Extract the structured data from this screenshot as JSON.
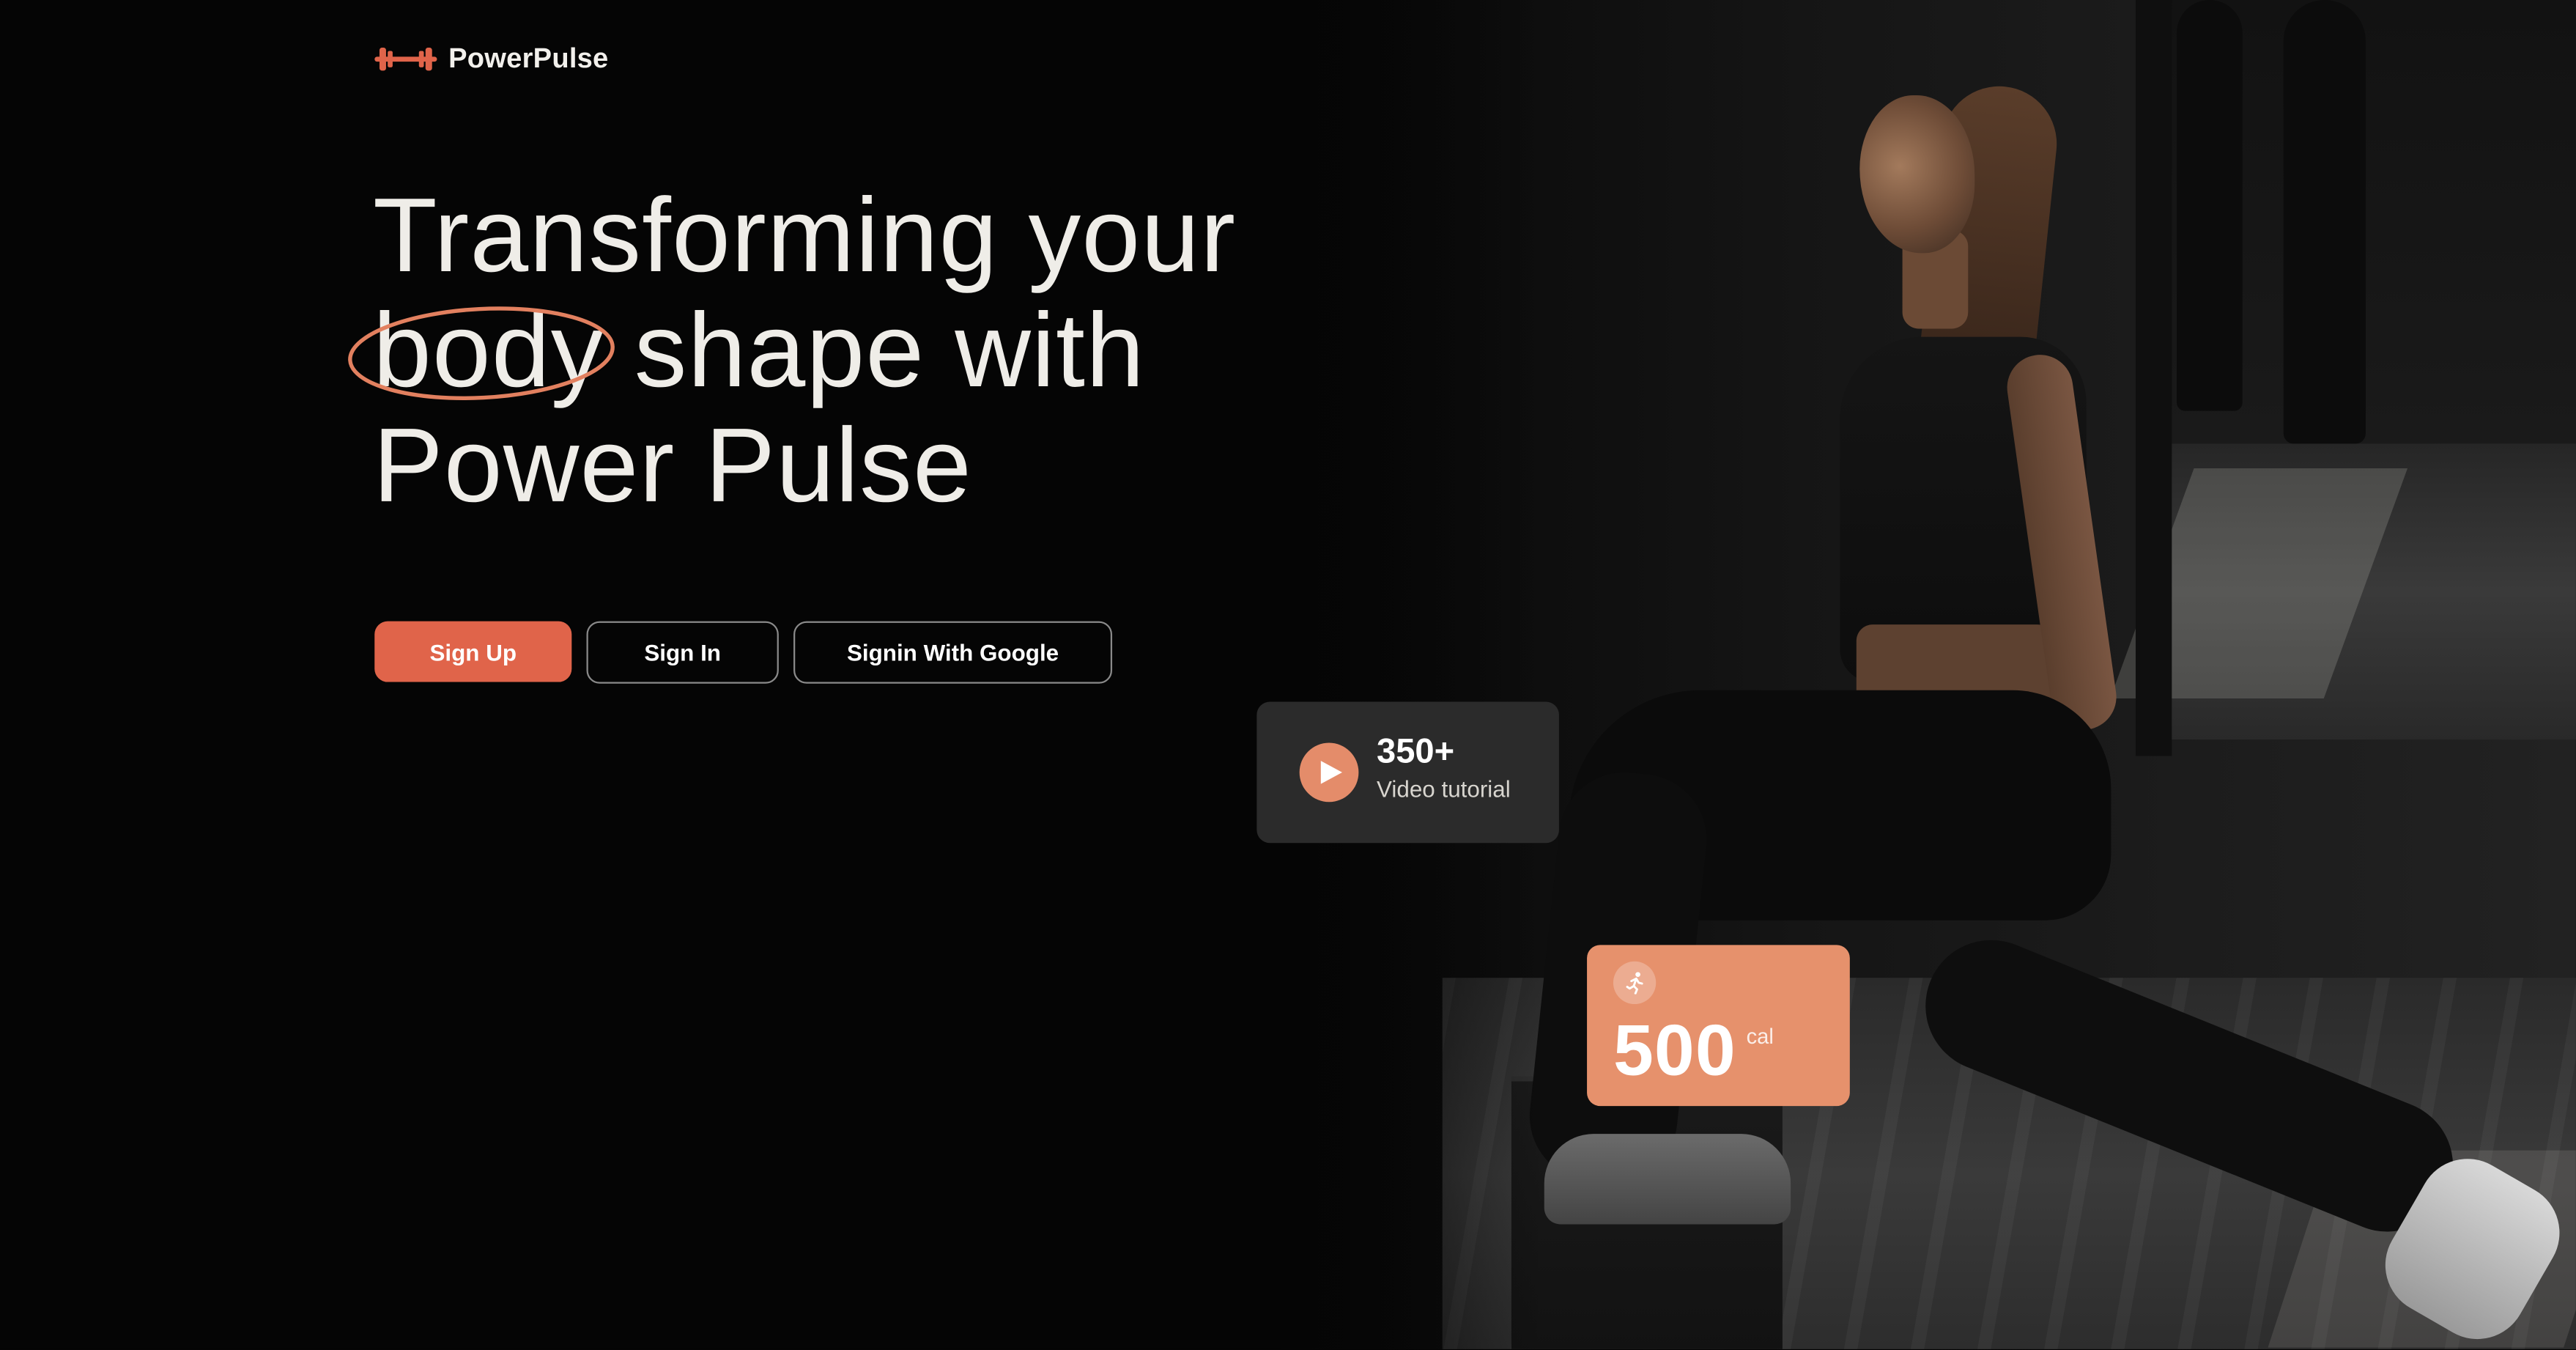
{
  "brand": {
    "name": "PowerPulse",
    "icon": "dumbbell-icon",
    "accent_color": "#e0644a"
  },
  "hero": {
    "title_line1": "Transforming your",
    "title_highlight": "body",
    "title_line2_rest": " shape with",
    "title_line3": "Power Pulse"
  },
  "actions": {
    "sign_up": "Sign Up",
    "sign_in": "Sign In",
    "google": "Signin With Google"
  },
  "stats": {
    "video": {
      "count": "350+",
      "label": "Video tutorial",
      "icon": "play-icon"
    },
    "calories": {
      "value": "500",
      "unit": "cal",
      "icon": "running-icon"
    }
  }
}
